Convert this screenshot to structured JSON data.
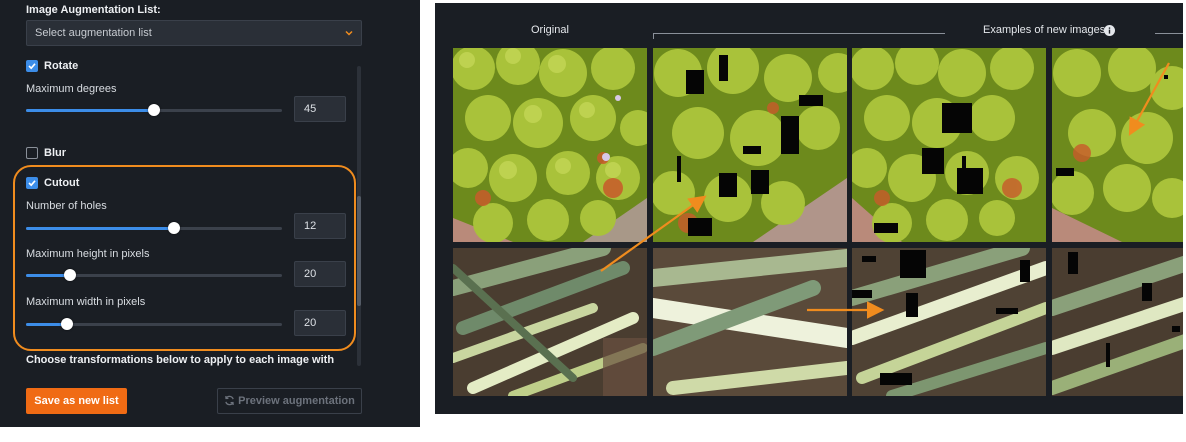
{
  "left_panel": {
    "list_title": "Image Augmentation List:",
    "select_placeholder": "Select augmentation list",
    "rotate": {
      "label": "Rotate",
      "checked": true,
      "max_degrees_label": "Maximum degrees",
      "max_degrees_value": "45",
      "slider_level": 0.5
    },
    "blur": {
      "label": "Blur",
      "checked": false
    },
    "cutout": {
      "label": "Cutout",
      "checked": true,
      "holes_label": "Number of holes",
      "holes_value": "12",
      "holes_level": 0.58,
      "height_label": "Maximum height in pixels",
      "height_value": "20",
      "height_level": 0.17,
      "width_label": "Maximum width in pixels",
      "width_value": "20",
      "width_level": 0.16
    },
    "instructions": "Choose transformations below to apply to each image with",
    "save_button": "Save as new list",
    "preview_button": "Preview augmentation"
  },
  "right_panel": {
    "original_label": "Original",
    "examples_label": "Examples of new images",
    "info_icon": "info-icon"
  },
  "colors": {
    "panel_bg": "#1a1e24",
    "accent_blue": "#3c8de8",
    "highlight_orange": "#f08c1e",
    "save_button": "#f06b14"
  }
}
